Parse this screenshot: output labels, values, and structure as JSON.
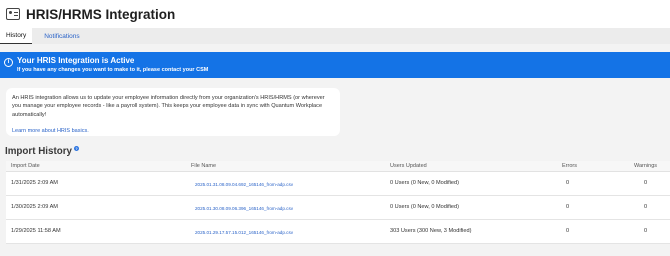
{
  "header": {
    "title": "HRIS/HRMS Integration",
    "icon": "id-card-icon"
  },
  "tabs": [
    {
      "label": "History",
      "active": true
    },
    {
      "label": "Notifications",
      "active": false
    }
  ],
  "banner": {
    "title": "Your HRIS Integration is Active",
    "subtitle": "If you have any changes you want to make to it, please contact your CSM",
    "icon": "info-icon",
    "color": "#1473e6"
  },
  "info": {
    "text": "An HRIS integration allows us to update your employee information directly from your organization's HRIS/HRMS (or wherever you manage your employee records - like a payroll system). This keeps your employee data in sync with Quantum Workplace automatically!",
    "link": "Learn more about HRIS basics."
  },
  "import_history": {
    "title": "Import History",
    "columns": [
      "Import Date",
      "File Name",
      "Users Updated",
      "Errors",
      "Warnings"
    ],
    "rows": [
      {
        "date": "1/31/2025 2:09 AM",
        "file": "2025.01.31.08.09.04.692_165146_from-adp.csv",
        "users": "0 Users (0 New, 0 Modified)",
        "errors": "0",
        "warnings": "0"
      },
      {
        "date": "1/30/2025 2:09 AM",
        "file": "2025.01.30.08.09.06.396_165146_from-adp.csv",
        "users": "0 Users (0 New, 0 Modified)",
        "errors": "0",
        "warnings": "0"
      },
      {
        "date": "1/29/2025 11:58 AM",
        "file": "2025.01.29.17.57.15.012_165146_from-adp.csv",
        "users": "303 Users (300 New, 3 Modified)",
        "errors": "0",
        "warnings": "0"
      }
    ]
  }
}
